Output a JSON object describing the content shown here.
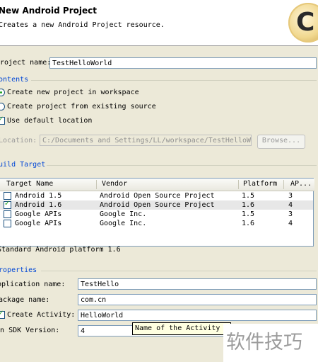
{
  "banner": {
    "title": "New Android Project",
    "description": "Creates a new Android Project resource.",
    "logo_text": "C"
  },
  "project": {
    "name_label": "Project name:",
    "name_value": "TestHelloWorld"
  },
  "contents": {
    "title": "Contents",
    "radio_new_label": "Create new project in workspace",
    "radio_existing_label": "Create project from existing source",
    "default_location_label": "Use default location",
    "location_label": "Location:",
    "location_value": "C:/Documents and Settings/LL/workspace/TestHelloWorld",
    "browse_label": "Browse..."
  },
  "build_target": {
    "title": "Build Target",
    "columns": [
      "Target Name",
      "Vendor",
      "Platform",
      "AP..."
    ],
    "rows": [
      {
        "name": "Android 1.5",
        "vendor": "Android Open Source Project",
        "platform": "1.5",
        "api": "3",
        "checked": false
      },
      {
        "name": "Android 1.6",
        "vendor": "Android Open Source Project",
        "platform": "1.6",
        "api": "4",
        "checked": true
      },
      {
        "name": "Google APIs",
        "vendor": "Google Inc.",
        "platform": "1.5",
        "api": "3",
        "checked": false
      },
      {
        "name": "Google APIs",
        "vendor": "Google Inc.",
        "platform": "1.6",
        "api": "4",
        "checked": false
      }
    ],
    "status": "Standard Android platform 1.6"
  },
  "properties": {
    "title": "Properties",
    "app_name_label": "Application name:",
    "app_name_value": "TestHello",
    "package_label": "Package name:",
    "package_value": "com.cn",
    "activity_label": "Create Activity:",
    "activity_value": "HelloWorld",
    "min_sdk_label": "Min SDK Version:",
    "min_sdk_value": "4"
  },
  "tooltip": "Name of the Activity class",
  "watermark": "软件技巧",
  "colors": {
    "group_title": "#0046d5",
    "selected_row": "#e7e7e7",
    "check_green": "#21a121"
  }
}
